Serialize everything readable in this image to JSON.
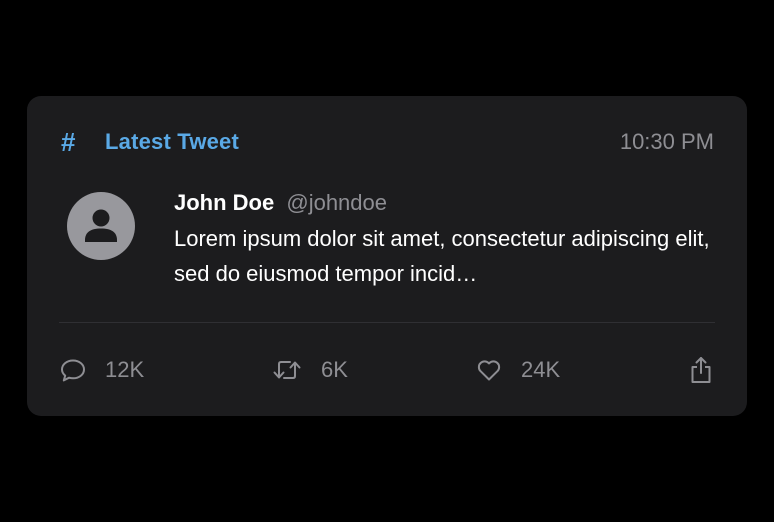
{
  "header": {
    "title": "Latest Tweet",
    "time": "10:30 PM",
    "icon": "hash-icon"
  },
  "tweet": {
    "name": "John Doe",
    "handle": "@johndoe",
    "text": "Lorem ipsum dolor sit amet, consectetur adipiscing elit, sed do eiusmod tempor incid…",
    "avatar_icon": "person-icon"
  },
  "actions": {
    "replies": "12K",
    "retweets": "6K",
    "likes": "24K"
  },
  "colors": {
    "accent": "#5aa9e6",
    "card_background": "#1c1c1e",
    "secondary_text": "#8e8e93",
    "page_background": "#000000"
  }
}
